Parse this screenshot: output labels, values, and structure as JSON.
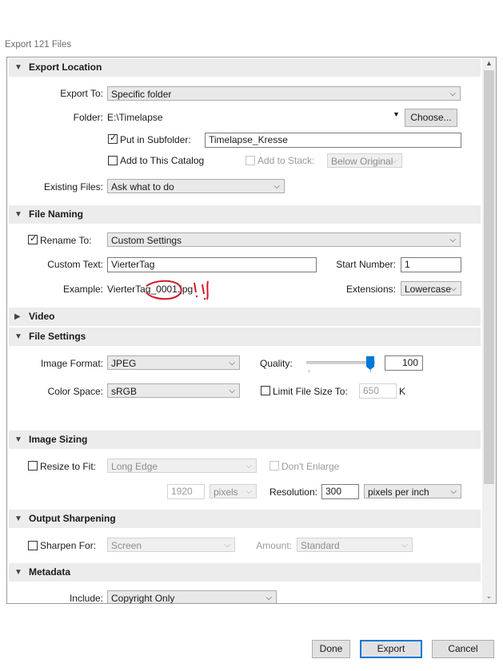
{
  "window": {
    "title": "Export 121 Files"
  },
  "sections": {
    "export_location": "Export Location",
    "file_naming": "File Naming",
    "video": "Video",
    "file_settings": "File Settings",
    "image_sizing": "Image Sizing",
    "output_sharpening": "Output Sharpening",
    "metadata": "Metadata"
  },
  "export_location": {
    "export_to_label": "Export To:",
    "export_to_value": "Specific folder",
    "folder_label": "Folder:",
    "folder_path": "E:\\Timelapse",
    "choose_button": "Choose...",
    "put_in_subfolder_label": "Put in Subfolder:",
    "put_in_subfolder_checked": true,
    "subfolder_value": "Timelapse_Kresse",
    "add_to_catalog_label": "Add to This Catalog",
    "add_to_stack_label": "Add to Stack:",
    "stack_value": "Below Original",
    "existing_files_label": "Existing Files:",
    "existing_files_value": "Ask what to do"
  },
  "file_naming": {
    "rename_to_label": "Rename To:",
    "rename_to_checked": true,
    "rename_to_value": "Custom Settings",
    "custom_text_label": "Custom Text:",
    "custom_text_value": "VierterTag",
    "start_number_label": "Start Number:",
    "start_number_value": "1",
    "example_label": "Example:",
    "example_value": "VierterTag_0001.jpg",
    "extensions_label": "Extensions:",
    "extensions_value": "Lowercase",
    "annotation_color": "#d0182a"
  },
  "file_settings": {
    "image_format_label": "Image Format:",
    "image_format_value": "JPEG",
    "quality_label": "Quality:",
    "quality_value": "100",
    "quality_fraction": 1.0,
    "color_space_label": "Color Space:",
    "color_space_value": "sRGB",
    "limit_size_label": "Limit File Size To:",
    "limit_size_value": "650",
    "limit_size_unit": "K"
  },
  "image_sizing": {
    "resize_label": "Resize to Fit:",
    "resize_mode": "Long Edge",
    "dont_enlarge_label": "Don't Enlarge",
    "size_value": "1920",
    "size_unit": "pixels",
    "resolution_label": "Resolution:",
    "resolution_value": "300",
    "resolution_unit": "pixels per inch"
  },
  "output_sharpening": {
    "sharpen_for_label": "Sharpen For:",
    "sharpen_for_value": "Screen",
    "amount_label": "Amount:",
    "amount_value": "Standard"
  },
  "metadata": {
    "include_label": "Include:",
    "include_value": "Copyright Only"
  },
  "footer": {
    "done": "Done",
    "export": "Export",
    "cancel": "Cancel"
  },
  "colors": {
    "accent": "#0078d7",
    "section_bg": "#ececec"
  }
}
